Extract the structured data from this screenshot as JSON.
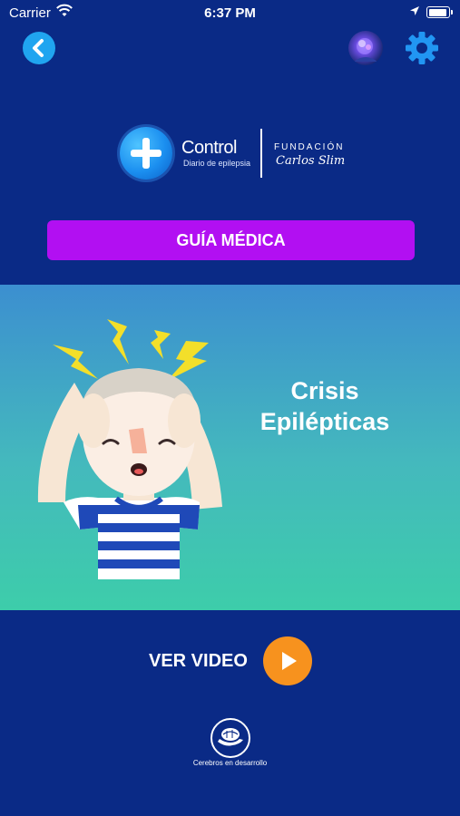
{
  "status_bar": {
    "carrier": "Carrier",
    "time": "6:37 PM",
    "battery_fraction": 1.0
  },
  "header": {
    "back_icon": "chevron-left-icon",
    "avatar_icon": "brain-avatar-icon",
    "settings_icon": "gear-icon"
  },
  "logo": {
    "title": "Control",
    "subtitle": "Diario de epilepsia",
    "partner_line1": "FUNDACIÓN",
    "partner_line2": "Carlos Slim"
  },
  "guide_button": {
    "label": "GUÍA MÉDICA"
  },
  "hero": {
    "title_line1": "Crisis",
    "title_line2": "Epilépticas"
  },
  "video": {
    "label": "VER VIDEO",
    "play_icon": "play-icon"
  },
  "footer": {
    "brand_label": "Cerebros en desarrollo"
  },
  "colors": {
    "background": "#0a2a86",
    "guide_button": "#b20ff2",
    "back_button": "#20a5f0",
    "play_button": "#f7921e",
    "settings": "#2196f3"
  }
}
